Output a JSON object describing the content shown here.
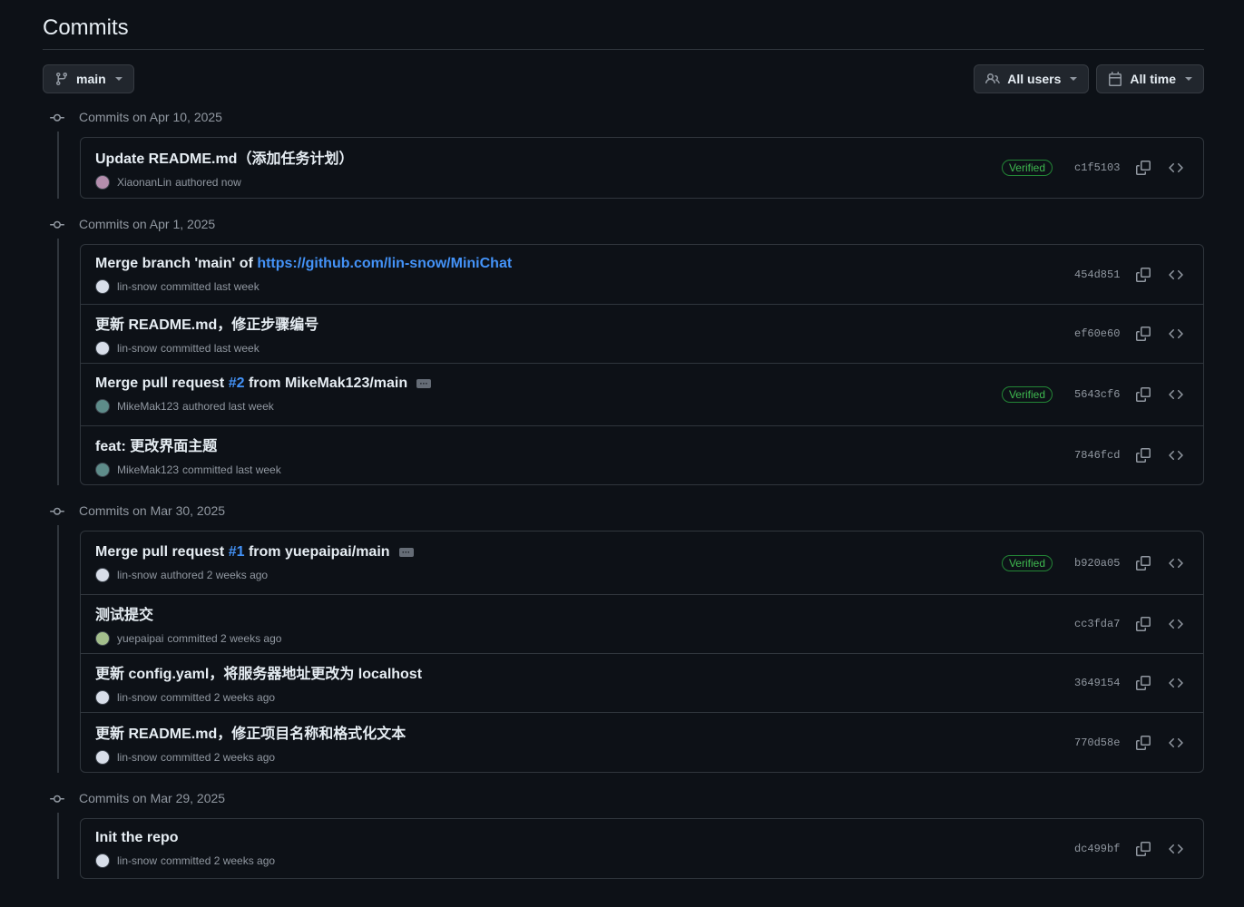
{
  "page": {
    "title": "Commits"
  },
  "toolbar": {
    "branch_label": "main",
    "users_label": "All users",
    "time_label": "All time"
  },
  "groups": [
    {
      "heading": "Commits on Apr 10, 2025",
      "commits": [
        {
          "msg": "Update README.md（添加任务计划）",
          "author": "XiaonanLin",
          "action": "authored now",
          "verified": "Verified",
          "sha": "c1f5103",
          "avatar_color": "#b48ead"
        }
      ]
    },
    {
      "heading": "Commits on Apr 1, 2025",
      "commits": [
        {
          "msg_pre": "Merge branch 'main' of ",
          "msg_link": "https://github.com/lin-snow/MiniChat",
          "author": "lin-snow",
          "action": "committed last week",
          "sha": "454d851",
          "avatar_color": "#d8dee9"
        },
        {
          "msg": "更新 README.md，修正步骤编号",
          "author": "lin-snow",
          "action": "committed last week",
          "sha": "ef60e60",
          "avatar_color": "#d8dee9"
        },
        {
          "msg_pre": "Merge pull request ",
          "msg_link": "#2",
          "msg_post": " from MikeMak123/main",
          "ellipsis": "···",
          "author": "MikeMak123",
          "action": "authored last week",
          "verified": "Verified",
          "sha": "5643cf6",
          "avatar_color": "#5e8c8a"
        },
        {
          "msg": "feat: 更改界面主题",
          "author": "MikeMak123",
          "action": "committed last week",
          "sha": "7846fcd",
          "avatar_color": "#5e8c8a"
        }
      ]
    },
    {
      "heading": "Commits on Mar 30, 2025",
      "commits": [
        {
          "msg_pre": "Merge pull request ",
          "msg_link": "#1",
          "msg_post": " from yuepaipai/main",
          "ellipsis": "···",
          "author": "lin-snow",
          "action": "authored 2 weeks ago",
          "verified": "Verified",
          "sha": "b920a05",
          "avatar_color": "#d8dee9"
        },
        {
          "msg": "测试提交",
          "author": "yuepaipai",
          "action": "committed 2 weeks ago",
          "sha": "cc3fda7",
          "avatar_color": "#a3be8c"
        },
        {
          "msg": "更新 config.yaml，将服务器地址更改为 localhost",
          "author": "lin-snow",
          "action": "committed 2 weeks ago",
          "sha": "3649154",
          "avatar_color": "#d8dee9"
        },
        {
          "msg": "更新 README.md，修正项目名称和格式化文本",
          "author": "lin-snow",
          "action": "committed 2 weeks ago",
          "sha": "770d58e",
          "avatar_color": "#d8dee9"
        }
      ]
    },
    {
      "heading": "Commits on Mar 29, 2025",
      "commits": [
        {
          "msg": "Init the repo",
          "author": "lin-snow",
          "action": "committed 2 weeks ago",
          "sha": "dc499bf",
          "avatar_color": "#d8dee9"
        }
      ]
    }
  ]
}
